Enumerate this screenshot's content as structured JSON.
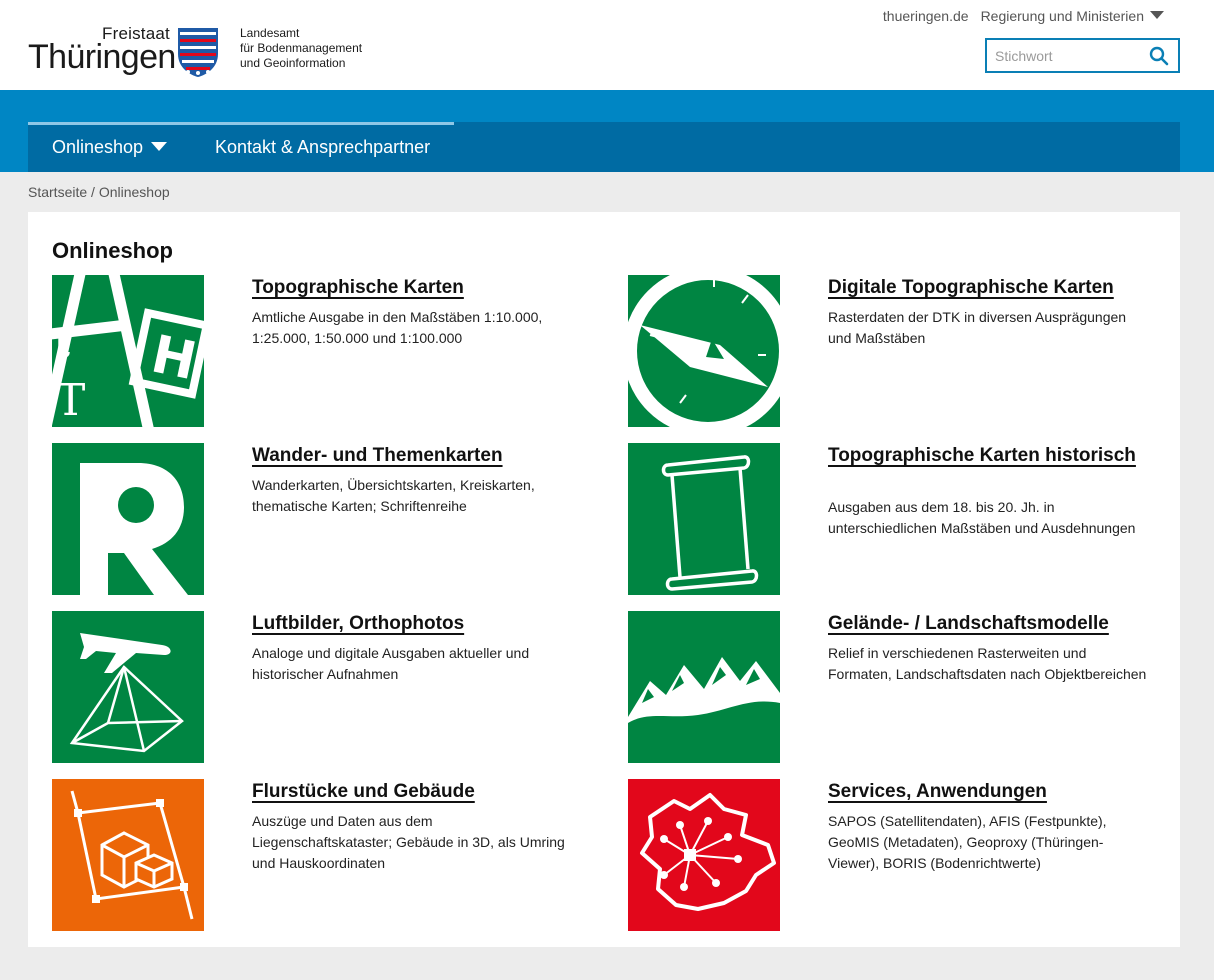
{
  "header": {
    "logo_freistaat": "Freistaat",
    "logo_thueringen": "Thüringen",
    "office_lines": [
      "Landesamt",
      "für Bodenmanagement",
      "und Geoinformation"
    ],
    "top_links": {
      "site": "thueringen.de",
      "government": "Regierung und Ministerien"
    },
    "search": {
      "placeholder": "Stichwort"
    }
  },
  "nav": {
    "items": [
      "Onlineshop",
      "Kontakt & Ansprechpartner"
    ]
  },
  "breadcrumb": {
    "home": "Startseite",
    "separator": " / ",
    "current": "Onlineshop"
  },
  "main": {
    "title": "Onlineshop",
    "cards": [
      {
        "title": "Topographische Karten",
        "desc": "Amtliche Ausgabe in den Maßstäben 1:10.000, 1:25.000, 1:50.000 und 1:100.000",
        "icon": "topographic-map-icon",
        "color": "#008542"
      },
      {
        "title": "Digitale Topographische Karten",
        "desc": "Rasterdaten der DTK in diversen Ausprägungen und Maßstäben",
        "icon": "compass-icon",
        "color": "#008542"
      },
      {
        "title": "Wander- und Themenkarten",
        "desc": "Wanderkarten, Übersichtskarten, Kreiskarten, thematische Karten; Schriftenreihe",
        "icon": "letter-r-icon",
        "color": "#008542"
      },
      {
        "title": "Topographische Karten historisch",
        "desc": "Ausgaben aus dem 18. bis 20. Jh. in unterschiedlichen Maßstäben und Ausdehnungen",
        "icon": "scroll-icon",
        "color": "#008542"
      },
      {
        "title": "Luftbilder, Orthophotos",
        "desc": "Analoge und digitale Ausgaben aktueller und historischer Aufnahmen",
        "icon": "airplane-icon",
        "color": "#008542"
      },
      {
        "title": "Gelände- / Landschaftsmodelle",
        "desc": "Relief in verschiedenen Rasterweiten und Formaten, Landschaftsdaten nach Objektbereichen",
        "icon": "mountains-icon",
        "color": "#008542"
      },
      {
        "title": "Flurstücke und Gebäude",
        "desc": "Auszüge und Daten aus dem Liegenschaftskataster; Gebäude in 3D, als Umring und Hauskoordinaten",
        "icon": "parcel-buildings-icon",
        "color": "#ec6608"
      },
      {
        "title": "Services, Anwendungen",
        "desc": "SAPOS (Satellitendaten), AFIS (Festpunkte), GeoMIS (Metadaten), Geoproxy (Thüringen-Viewer), BORIS (Bodenrichtwerte)",
        "icon": "network-map-icon",
        "color": "#e2071b"
      }
    ]
  }
}
